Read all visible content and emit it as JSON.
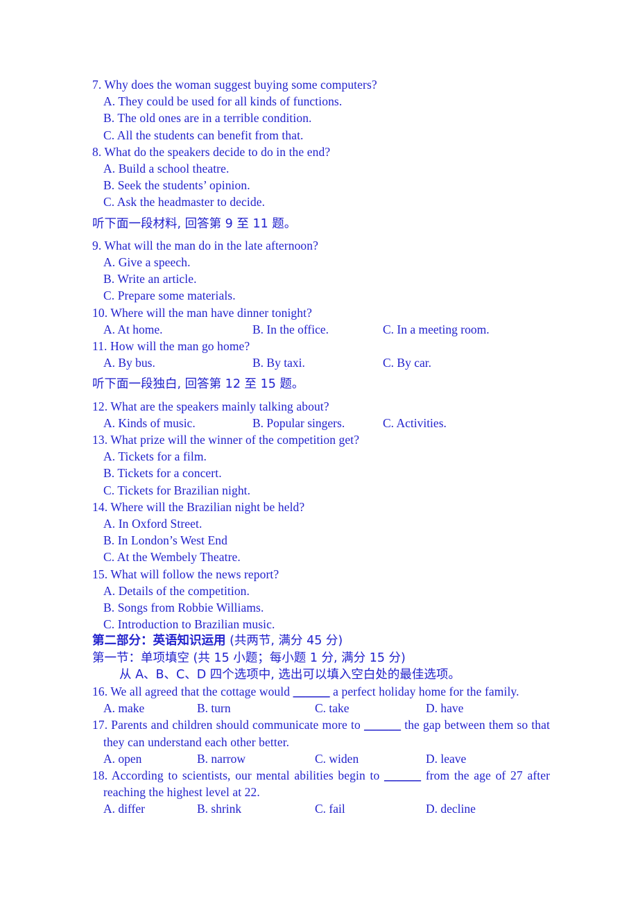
{
  "document": {
    "text_color": "#2222cc",
    "background": "#ffffff"
  },
  "listening": {
    "q7": {
      "stem": "7. Why does the woman suggest buying some computers?",
      "options": [
        "A. They could be used for all kinds of functions.",
        "B. The old ones are in a terrible condition.",
        "C. All the students can benefit from that."
      ]
    },
    "q8": {
      "stem": "8. What do the speakers decide to do in the end?",
      "options": [
        "A. Build a school theatre.",
        "B. Seek the students’ opinion.",
        "C. Ask the headmaster to decide."
      ]
    },
    "instruction_9_11": "听下面一段材料, 回答第 9 至 11 题。",
    "q9": {
      "stem": "9. What will the man do in the late afternoon?",
      "options": [
        "A. Give a speech.",
        "B. Write an article.",
        "C. Prepare some materials."
      ]
    },
    "q10": {
      "stem": "10. Where will the man have dinner tonight?",
      "options": [
        "A. At home.",
        "B. In the office.",
        "C. In a meeting room."
      ]
    },
    "q11": {
      "stem": "11. How will the man go home?",
      "options": [
        "A. By bus.",
        "B. By taxi.",
        "C. By car."
      ]
    },
    "instruction_12_15": "听下面一段独白, 回答第 12 至 15 题。",
    "q12": {
      "stem": "12. What are the speakers mainly talking about?",
      "options": [
        "A. Kinds of music.",
        "B. Popular singers.",
        "C. Activities."
      ]
    },
    "q13": {
      "stem": "13. What prize will the winner of the competition get?",
      "options": [
        "A. Tickets for a film.",
        "B. Tickets for a concert.",
        "C. Tickets for Brazilian night."
      ]
    },
    "q14": {
      "stem": "14. Where will the Brazilian night be held?",
      "options": [
        "A. In Oxford Street.",
        "B. In London’s West End",
        "C. At the Wembely Theatre."
      ]
    },
    "q15": {
      "stem": "15. What will follow the news report?",
      "options": [
        "A. Details of the competition.",
        "B. Songs from Robbie Williams.",
        "C. Introduction to Brazilian music."
      ]
    }
  },
  "part_two": {
    "heading_bold": "第二部分：英语知识运用",
    "heading_regular": " (共两节, 满分 45 分)",
    "section_one": "第一节：单项填空 (共 15 小题；每小题 1 分, 满分 15 分)",
    "directions": "从 A、B、C、D 四个选项中, 选出可以填入空白处的最佳选项。",
    "q16": {
      "stem_before": "16. We all agreed that the cottage would ",
      "blank": "______",
      "stem_after": " a perfect holiday home for the family.",
      "options": [
        "A. make",
        "B. turn",
        "C. take",
        "D. have"
      ]
    },
    "q17": {
      "stem_before": "17. Parents and children should communicate more to ",
      "blank": "______",
      "stem_after": " the gap between them so that",
      "stem_line2": "they can understand each other better.",
      "options": [
        "A. open",
        "B. narrow",
        "C. widen",
        "D. leave"
      ]
    },
    "q18": {
      "stem_before": "18. According to scientists, our mental abilities begin to ",
      "blank": "______",
      "stem_after": " from the age of 27 after",
      "stem_line2": "reaching the highest level at 22.",
      "options": [
        "A. differ",
        "B. shrink",
        "C. fail",
        "D. decline"
      ]
    }
  }
}
